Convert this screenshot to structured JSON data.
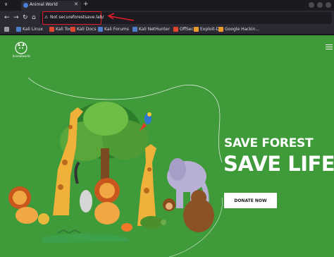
{
  "browser": {
    "tab_title": "Animal World",
    "new_tab": "+",
    "security_label": "Not secure",
    "url": "forestsave.lab/",
    "bookmarks": [
      {
        "label": "Kali Linux",
        "color": "#4e7ec7"
      },
      {
        "label": "Kali Tools",
        "color": "#e0452e"
      },
      {
        "label": "Kali Docs",
        "color": "#e0452e"
      },
      {
        "label": "Kali Forums",
        "color": "#4e7ec7"
      },
      {
        "label": "Kali NetHunter",
        "color": "#4e7ec7"
      },
      {
        "label": "OffSec",
        "color": "#e0452e"
      },
      {
        "label": "Exploit-DB",
        "color": "#e89a2b"
      },
      {
        "label": "Google Hackin...",
        "color": "#e89a2b"
      }
    ]
  },
  "site": {
    "brand_color": "#3f9a3a",
    "logo_caption": "Animalworld",
    "hero": {
      "headline_small": "SAVE FOREST",
      "headline_large": "SAVE LIFE",
      "cta_label": "DONATE NOW"
    }
  }
}
